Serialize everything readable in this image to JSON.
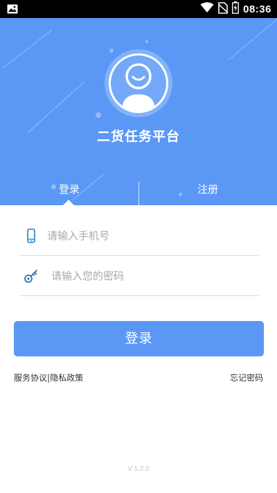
{
  "status_bar": {
    "time": "08:36",
    "icons": [
      "image-icon",
      "wifi-icon",
      "no-sim-icon",
      "battery-charging-icon"
    ]
  },
  "header": {
    "app_title": "二货任务平台",
    "avatar_icon": "smiley-user-icon",
    "tabs": [
      {
        "label": "登录",
        "active": true
      },
      {
        "label": "注册",
        "active": false
      }
    ]
  },
  "form": {
    "phone": {
      "icon": "phone-icon",
      "value": "",
      "placeholder": "请输入手机号"
    },
    "password": {
      "icon": "key-icon",
      "value": "",
      "placeholder": "请输入您的密码"
    },
    "submit_label": "登录"
  },
  "links": {
    "service_agreement": "服务协议",
    "separator": "|",
    "privacy_policy": "隐私政策",
    "forgot_password": "忘记密码"
  },
  "version": "V 1.2.0",
  "colors": {
    "primary": "#5b98f6",
    "avatar_fill": "#74a9f9",
    "status_bar": "#000000",
    "placeholder": "#a8a8a8"
  }
}
